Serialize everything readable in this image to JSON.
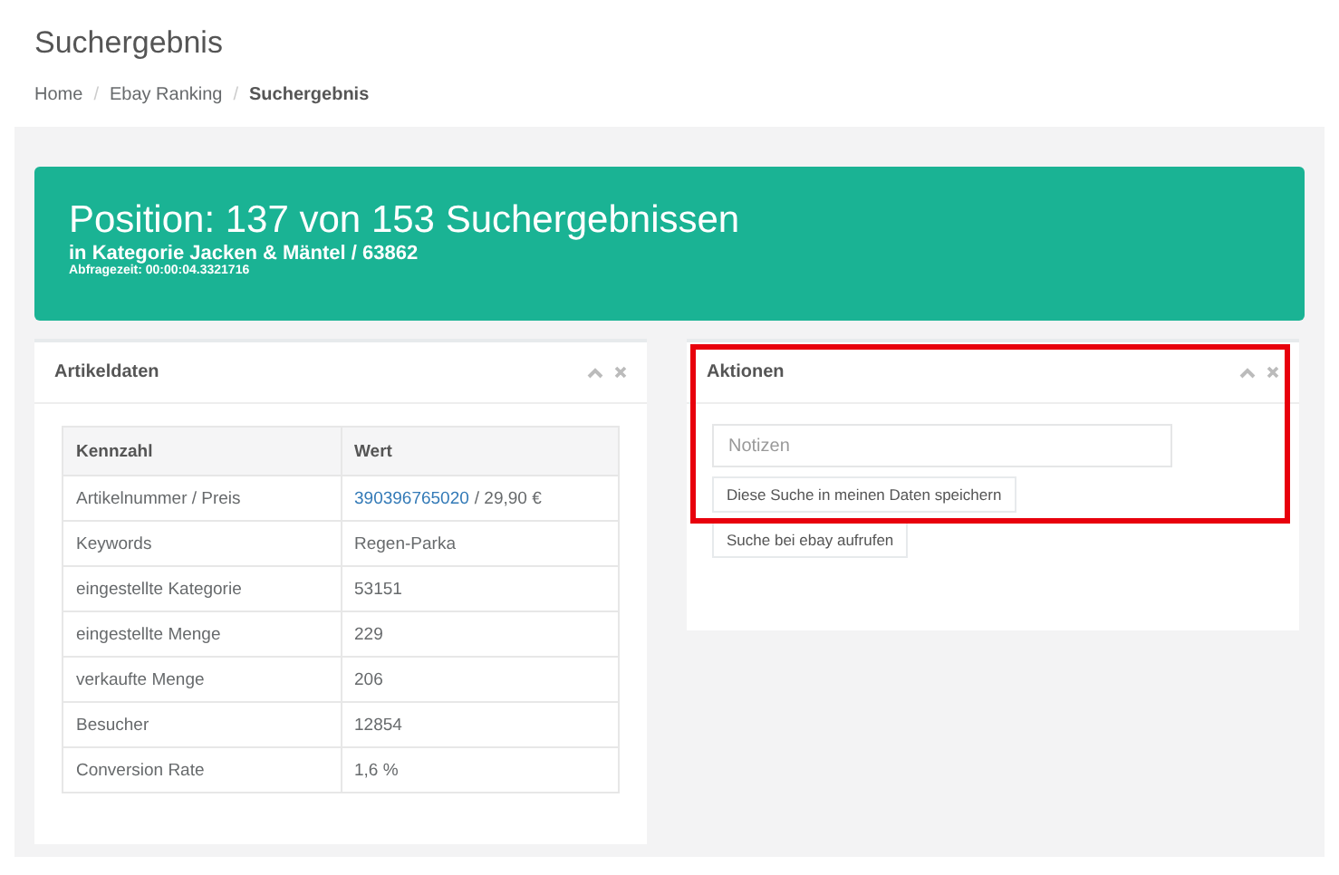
{
  "page_title": "Suchergebnis",
  "breadcrumb_separator": "/",
  "breadcrumb": [
    {
      "label": "Home",
      "current": false
    },
    {
      "label": "Ebay Ranking",
      "current": false
    },
    {
      "label": "Suchergebnis",
      "current": true
    }
  ],
  "banner": {
    "title": "Position: 137 von 153 Suchergebnissen",
    "subtitle": "in Kategorie Jacken & Mäntel / 63862",
    "query_time": "Abfragezeit: 00:00:04.3321716"
  },
  "article_panel": {
    "title": "Artikeldaten",
    "columns": [
      "Kennzahl",
      "Wert"
    ],
    "rows": [
      {
        "label": "Artikelnummer / Preis",
        "link": "390396765020",
        "value": "/ 29,90 €"
      },
      {
        "label": "Keywords",
        "value": "Regen-Parka"
      },
      {
        "label": "eingestellte Kategorie",
        "value": "53151"
      },
      {
        "label": "eingestellte Menge",
        "value": "229"
      },
      {
        "label": "verkaufte Menge",
        "value": "206"
      },
      {
        "label": "Besucher",
        "value": "12854"
      },
      {
        "label": "Conversion Rate",
        "value": "1,6 %"
      }
    ]
  },
  "actions_panel": {
    "title": "Aktionen",
    "highlighted": true,
    "notes": {
      "placeholder": "Notizen"
    },
    "buttons": [
      "Diese Suche in meinen Daten speichern",
      "Suche bei ebay aufrufen"
    ]
  }
}
